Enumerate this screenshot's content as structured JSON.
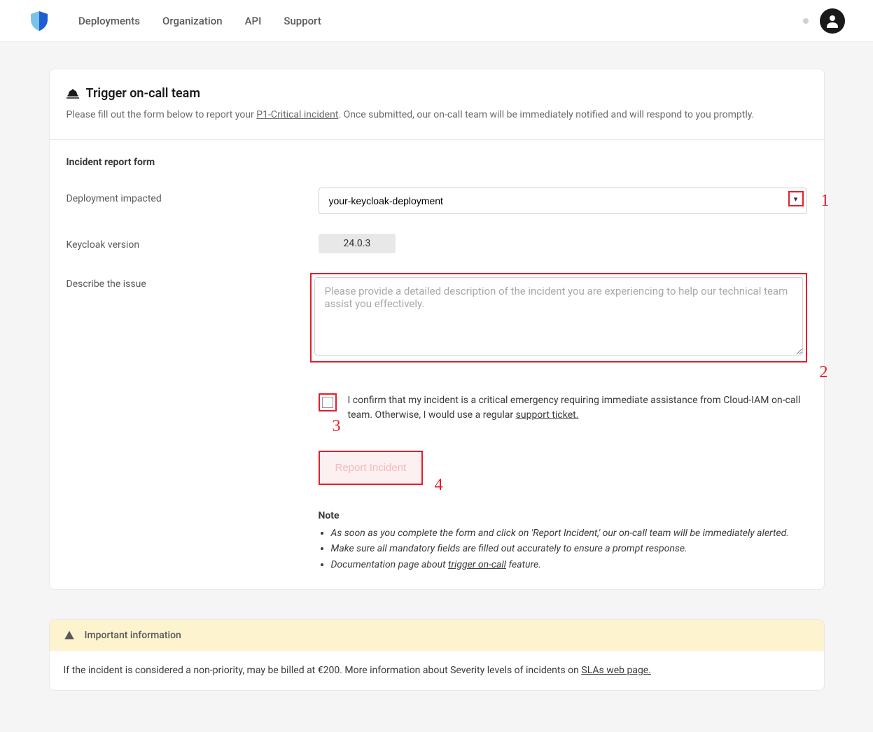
{
  "nav": {
    "deployments": "Deployments",
    "organization": "Organization",
    "api": "API",
    "support": "Support"
  },
  "header": {
    "title": "Trigger on-call team",
    "subtitle_before": "Please fill out the form below to report your ",
    "subtitle_link": "P1-Critical incident",
    "subtitle_after": ". Once submitted, our on-call team will be immediately notified and will respond to you promptly."
  },
  "form": {
    "section_title": "Incident report form",
    "deployment_label": "Deployment impacted",
    "deployment_value": "your-keycloak-deployment",
    "version_label": "Keycloak version",
    "version_value": "24.0.3",
    "describe_label": "Describe the issue",
    "describe_placeholder": "Please provide a detailed description of the incident you are experiencing to help our technical team assist you effectively.",
    "confirm_before": "I confirm that my incident is a critical emergency requiring immediate assistance from Cloud-IAM on-call team. Otherwise, I would use a regular ",
    "confirm_link": "support ticket.",
    "submit_label": "Report Incident"
  },
  "notes": {
    "title": "Note",
    "item1": "As soon as you complete the form and click on 'Report Incident,' our on-call team will be immediately alerted.",
    "item2": "Make sure all mandatory fields are filled out accurately to ensure a prompt response.",
    "item3_before": "Documentation page about ",
    "item3_link": "trigger on-call",
    "item3_after": " feature."
  },
  "info": {
    "title": "Important information",
    "body_before": "If the incident is considered a non-priority, may be billed at €200. More information about Severity levels of incidents on ",
    "body_link": "SLAs web page."
  },
  "annotations": {
    "a1": "1",
    "a2": "2",
    "a3": "3",
    "a4": "4"
  }
}
